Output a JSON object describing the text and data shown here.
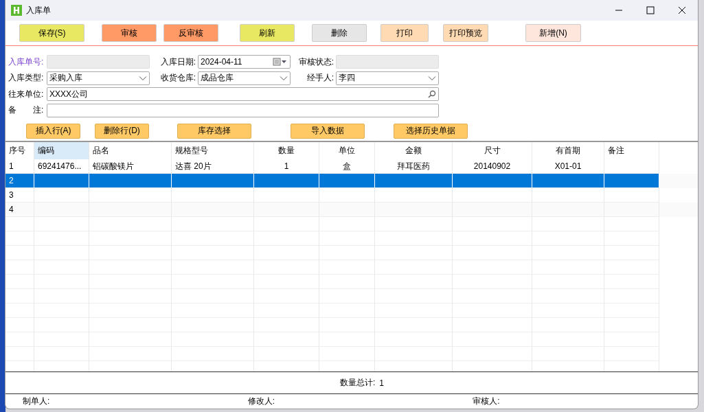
{
  "window": {
    "title": "入库单"
  },
  "toolbar": [
    {
      "label": "保存(S)",
      "color": "#e8e862"
    },
    {
      "label": "审核",
      "color": "#ff9966"
    },
    {
      "label": "反审核",
      "color": "#ff9966"
    },
    {
      "label": "刷新",
      "color": "#e8e862"
    },
    {
      "label": "删除",
      "color": "#e6e6e6"
    },
    {
      "label": "打印",
      "color": "#ffdab3"
    },
    {
      "label": "打印预览",
      "color": "#ffdab3"
    },
    {
      "label": "新增(N)",
      "color": "#ffe6dd"
    }
  ],
  "form": {
    "order_no": {
      "label": "入库单号:"
    },
    "date": {
      "label": "入库日期:",
      "value": "2024-04-11"
    },
    "audit_status": {
      "label": "审核状态:"
    },
    "type": {
      "label": "入库类型:",
      "value": "采购入库"
    },
    "warehouse": {
      "label": "收货仓库:",
      "value": "成品仓库"
    },
    "handler": {
      "label": "经手人:",
      "value": "李四"
    },
    "partner": {
      "label": "往来单位:",
      "value": "XXXX公司"
    },
    "remark": {
      "label": "备　　注:"
    }
  },
  "actions": [
    "插入行(A)",
    "删除行(D)",
    "库存选择",
    "导入数据",
    "选择历史单据"
  ],
  "table": {
    "columns": [
      {
        "label": "序号",
        "selected": false
      },
      {
        "label": "编码",
        "selected": true
      },
      {
        "label": "品名",
        "selected": false
      },
      {
        "label": "规格型号",
        "selected": false
      },
      {
        "label": "数量",
        "selected": false
      },
      {
        "label": "单位",
        "selected": false
      },
      {
        "label": "金额",
        "selected": false
      },
      {
        "label": "尺寸",
        "selected": false
      },
      {
        "label": "有首期",
        "selected": false
      },
      {
        "label": "备注",
        "selected": false
      }
    ],
    "rows": [
      {
        "selected": false,
        "cells": [
          "1",
          "69241476...",
          "铝碳酸镁片",
          "达喜 20片",
          "1",
          "盒",
          "拜耳医药",
          "20140902",
          "X01-01"
        ]
      },
      {
        "selected": true,
        "cells": [
          "2"
        ]
      },
      {
        "selected": false,
        "cells": [
          "3"
        ]
      },
      {
        "selected": false,
        "cells": [
          "4"
        ]
      }
    ]
  },
  "total": {
    "label": "数量总计:",
    "value": "1"
  },
  "footer": [
    "制单人:",
    "修改人:",
    "审核人:"
  ]
}
